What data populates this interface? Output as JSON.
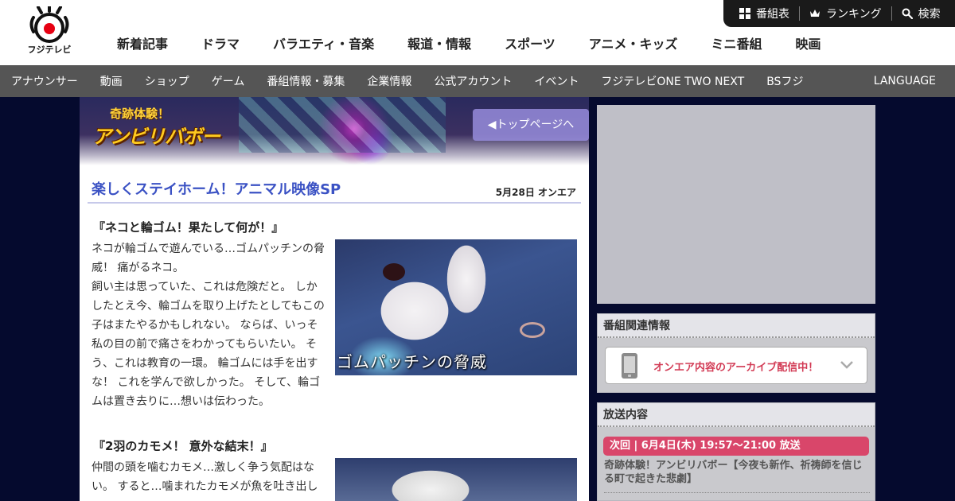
{
  "header": {
    "logo_text": "フジテレビ",
    "main_nav": [
      "新着記事",
      "ドラマ",
      "バラエティ・音楽",
      "報道・情報",
      "スポーツ",
      "アニメ・キッズ",
      "ミニ番組",
      "映画"
    ],
    "utility": [
      {
        "label": "番組表",
        "icon": "grid-icon"
      },
      {
        "label": "ランキング",
        "icon": "crown-icon"
      },
      {
        "label": "検索",
        "icon": "search-icon"
      }
    ]
  },
  "sub_nav": {
    "items": [
      "アナウンサー",
      "動画",
      "ショップ",
      "ゲーム",
      "番組情報・募集",
      "企業情報",
      "公式アカウント",
      "イベント",
      "フジテレビONE TWO NEXT",
      "BSフジ"
    ],
    "language": "LANGUAGE"
  },
  "banner": {
    "logo_small": "奇跡体験！",
    "logo_main": "アンビリバボー",
    "top_button": "◀トップページへ"
  },
  "episode": {
    "title": "楽しくステイホーム！アニマル映像SP",
    "date": "5月28日 オンエア",
    "sections": [
      {
        "title": "『ネコと輪ゴム！果たして何が！』",
        "text": "ネコが輪ゴムで遊んでいる…ゴムパッチンの脅威！ 痛がるネコ。\n飼い主は思っていた、これは危険だと。 しかしたとえ今、輪ゴムを取り上げたとしてもこの子はまたやるかもしれない。 ならば、いっそ私の目の前で痛さをわかってもらいたい。 そう、これは教育の一環。 輪ゴムには手を出すな！ これを学んで欲しかった。 そして、輪ゴムは置き去りに…想いは伝わった。",
        "image_caption": "ゴムパッチンの脅威"
      },
      {
        "title": "『2羽のカモメ！ 意外な結末！』",
        "text": "仲間の頭を噛むカモメ…激しく争う気配はない。 すると…噛まれたカモメが魚を吐き出し"
      }
    ]
  },
  "sidebar": {
    "related_heading": "番組関連情報",
    "archive_label": "オンエア内容のアーカイブ配信中！",
    "broadcast_heading": "放送内容",
    "next_badge": "次回 | 6月4日(木) 19:57～21:00 放送",
    "next_desc": "奇跡体験！アンビリバボー【今夜も新作、祈祷師を信じる町で起きた悲劇】"
  }
}
